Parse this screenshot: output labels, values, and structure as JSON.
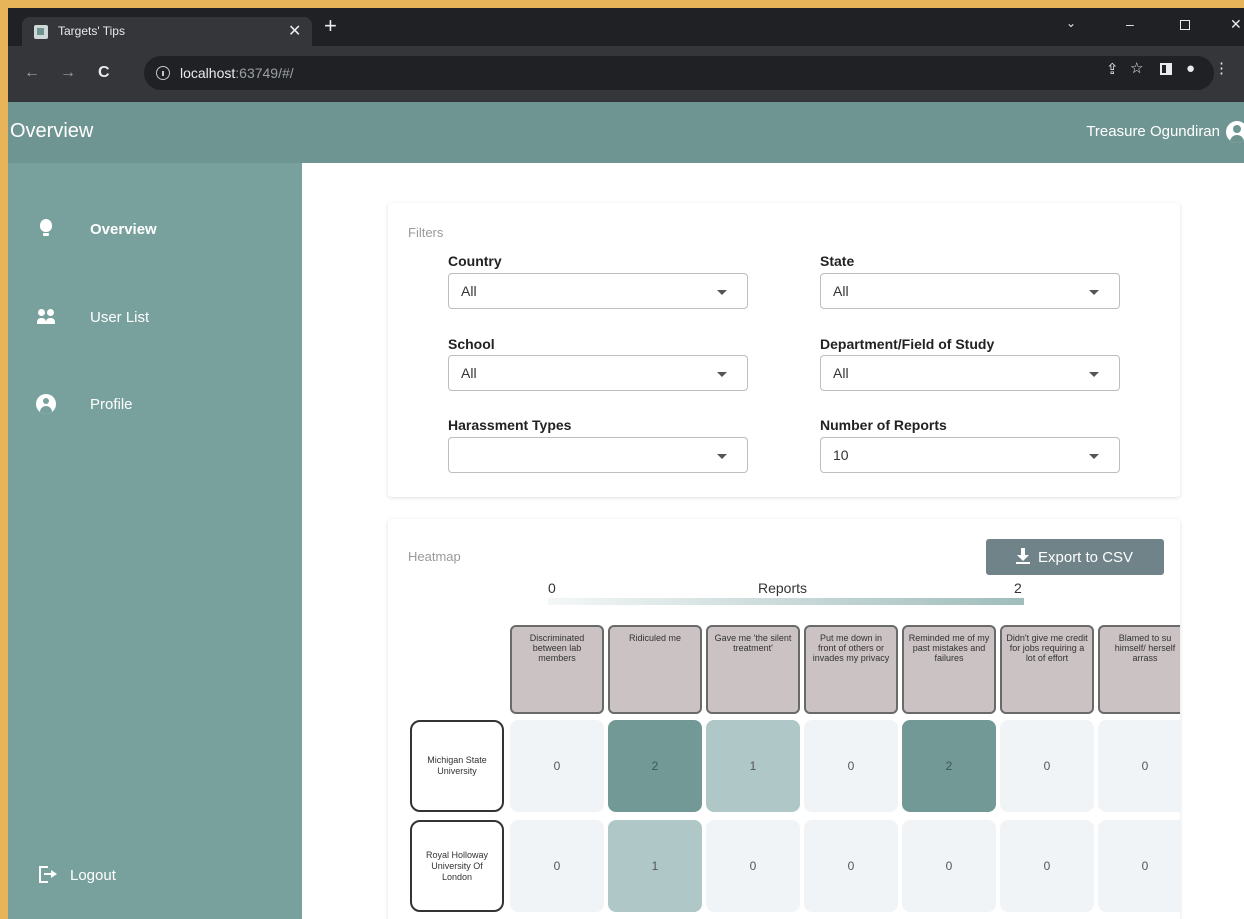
{
  "browser": {
    "tab_title": "Targets' Tips",
    "tab_close": "✕",
    "new_tab": "+",
    "url_host": "localhost",
    "url_rest": ":63749/#/"
  },
  "header": {
    "title": "Overview",
    "user_name": "Treasure Ogundiran"
  },
  "sidebar": {
    "items": [
      {
        "label": "Overview",
        "icon": "lightbulb-icon"
      },
      {
        "label": "User List",
        "icon": "people-icon"
      },
      {
        "label": "Profile",
        "icon": "account-circle-icon"
      }
    ],
    "logout": {
      "label": "Logout",
      "icon": "logout-icon"
    }
  },
  "filters": {
    "title": "Filters",
    "country": {
      "label": "Country",
      "value": "All"
    },
    "state": {
      "label": "State",
      "value": "All"
    },
    "school": {
      "label": "School",
      "value": "All"
    },
    "department": {
      "label": "Department/Field of Study",
      "value": "All"
    },
    "harassment": {
      "label": "Harassment Types",
      "value": ""
    },
    "reports": {
      "label": "Number of Reports",
      "value": "10"
    }
  },
  "heatmap": {
    "title": "Heatmap",
    "export_label": "Export to CSV",
    "legend": {
      "min": "0",
      "max": "2",
      "title": "Reports"
    },
    "colors": {
      "low": "#f1f4f6",
      "mid": "#afc8c7",
      "high": "#739997"
    }
  },
  "chart_data": {
    "type": "heatmap",
    "title": "Heatmap",
    "colorbar": {
      "label": "Reports",
      "min": 0,
      "max": 2
    },
    "columns": [
      "Discriminated between lab members",
      "Ridiculed me",
      "Gave me 'the silent treatment'",
      "Put me down in front of others or invades my privacy",
      "Reminded me of my past mistakes and failures",
      "Didn't give me credit for jobs requiring a lot of effort",
      "Blamed to su himself/ herself arrass"
    ],
    "rows": [
      "Michigan State University",
      "Royal Holloway University Of London"
    ],
    "values": [
      [
        0,
        2,
        1,
        0,
        2,
        0,
        0
      ],
      [
        0,
        1,
        0,
        0,
        0,
        0,
        0
      ]
    ]
  }
}
